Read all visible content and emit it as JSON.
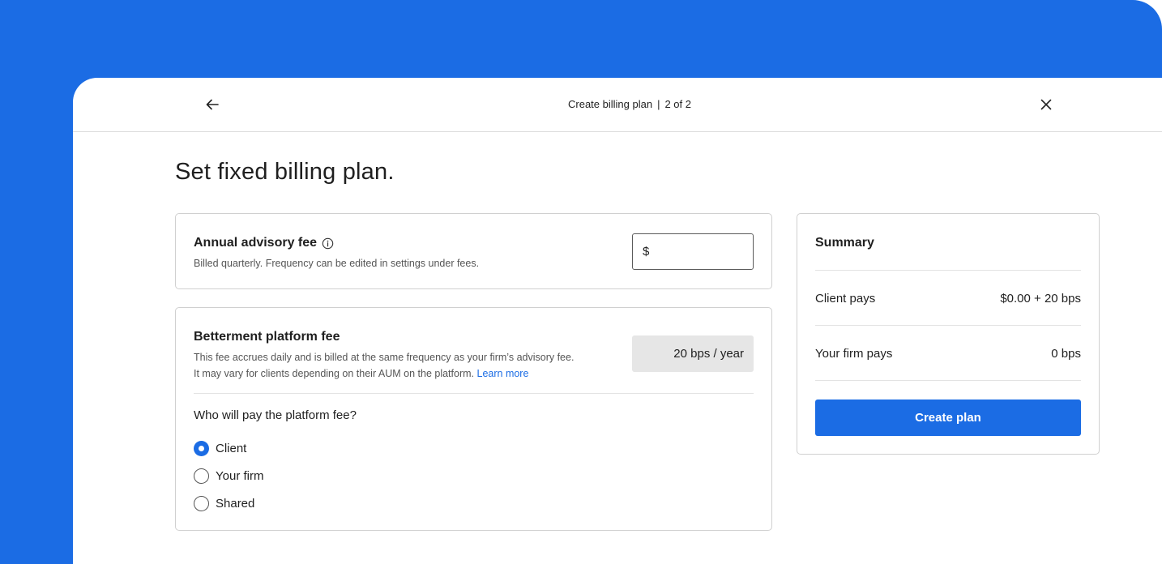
{
  "colors": {
    "accent": "#1b6ce4",
    "background_blue": "#1b6ce4"
  },
  "header": {
    "back_icon": "arrow-left-icon",
    "title": "Create billing plan",
    "separator": "|",
    "step": "2 of 2",
    "close_icon": "close-icon"
  },
  "page": {
    "title": "Set fixed billing plan."
  },
  "advisory": {
    "title": "Annual advisory fee",
    "info_icon": "info-icon",
    "description": "Billed quarterly. Frequency can be edited in settings under fees.",
    "currency_symbol": "$",
    "value": ""
  },
  "platform": {
    "title": "Betterment platform fee",
    "description_line1": "This fee accrues daily and is billed at the same frequency as your firm’s advisory fee.",
    "description_line2": "It may vary for clients depending on their AUM on the platform.",
    "learn_more": "Learn more",
    "fee": "20 bps / year",
    "question": "Who will pay the platform fee?",
    "options": [
      {
        "label": "Client",
        "checked": true
      },
      {
        "label": "Your firm",
        "checked": false
      },
      {
        "label": "Shared",
        "checked": false
      }
    ]
  },
  "summary": {
    "title": "Summary",
    "rows": [
      {
        "label": "Client pays",
        "value": "$0.00 + 20 bps"
      },
      {
        "label": "Your firm pays",
        "value": "0 bps"
      }
    ],
    "button": "Create plan"
  }
}
